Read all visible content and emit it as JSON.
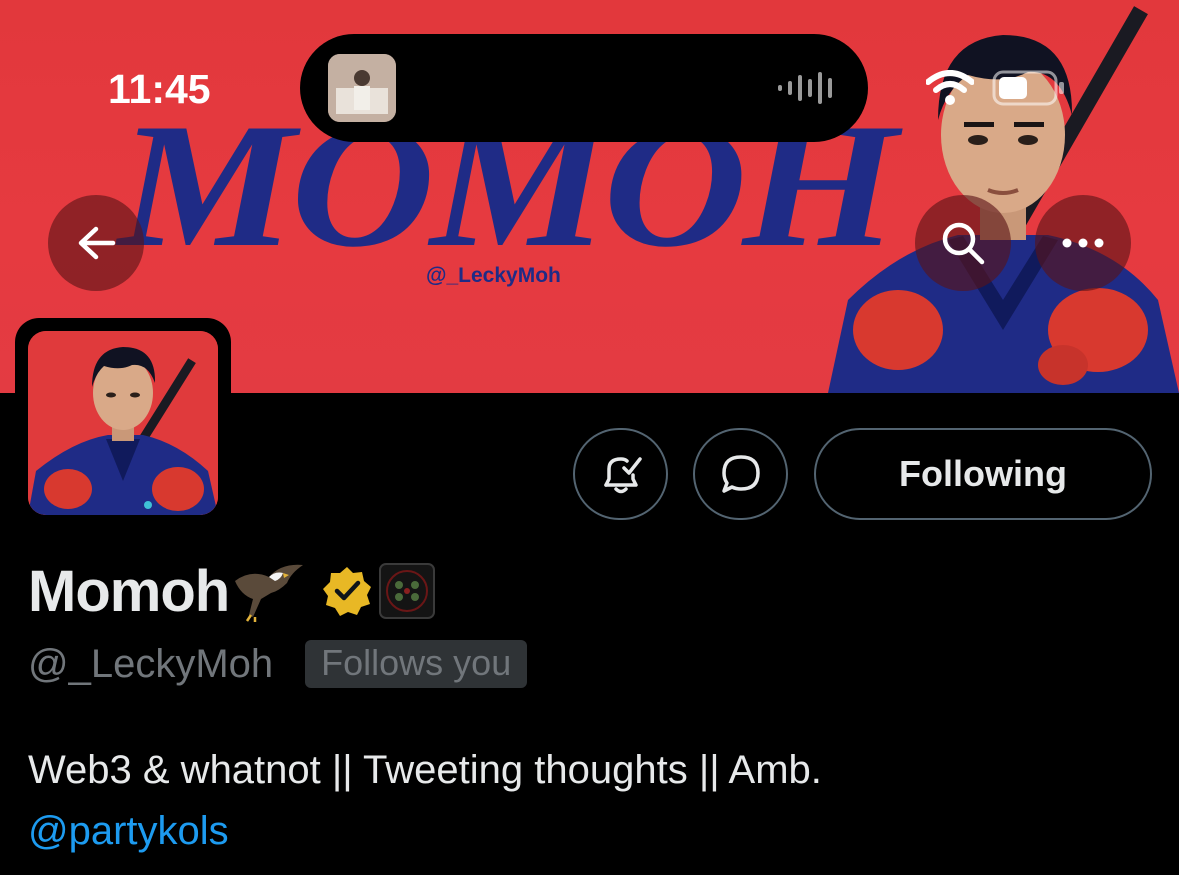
{
  "status_bar": {
    "time": "11:45",
    "icons": [
      "wifi-icon",
      "battery-icon"
    ]
  },
  "dynamic_island": {
    "thumb_icon": "now-playing-thumbnail",
    "wave_icon": "audio-waveform-icon"
  },
  "banner": {
    "title": "MOMOH",
    "handle": "@_LeckyMoh",
    "background_color": "#e63a40",
    "title_color": "#1f2b86"
  },
  "nav": {
    "back_icon": "arrow-left-icon",
    "search_icon": "search-icon",
    "more_icon": "more-horizontal-icon"
  },
  "profile": {
    "display_name": "Momoh",
    "name_emoji": "eagle-emoji",
    "verified_badge": "verified-gold-badge-icon",
    "affiliate_badge": "affiliate-badge-icon",
    "handle": "@_LeckyMoh",
    "follows_you_label": "Follows you",
    "bio": "Web3 & whatnot || Tweeting thoughts || Amb.",
    "bio_link": "@partykols"
  },
  "actions": {
    "notify_icon": "bell-check-icon",
    "message_icon": "message-bubble-icon",
    "following_label": "Following"
  },
  "colors": {
    "background": "#000000",
    "text_primary": "#e7e9ea",
    "text_secondary": "#71767b",
    "link": "#1d9bf0",
    "border": "#536471"
  }
}
